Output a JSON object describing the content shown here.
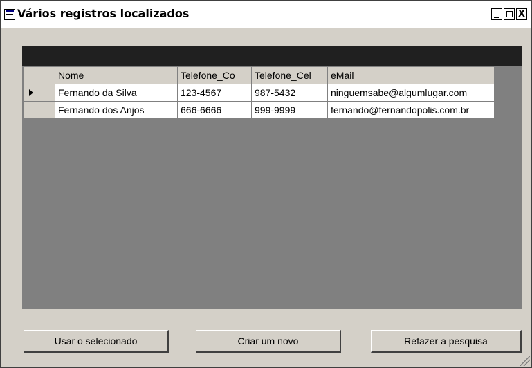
{
  "window": {
    "title": "Vários registros localizados",
    "controls": {
      "minimize": "_",
      "maximize": "□",
      "close": "X"
    }
  },
  "grid": {
    "columns": [
      "Nome",
      "Telefone_Co",
      "Telefone_Cel",
      "eMail"
    ],
    "rows": [
      {
        "selected": true,
        "cells": [
          "Fernando da Silva",
          "123-4567",
          "987-5432",
          "ninguemsabe@algumlugar.com"
        ]
      },
      {
        "selected": false,
        "cells": [
          "Fernando dos Anjos",
          "666-6666",
          "999-9999",
          "fernando@fernandopolis.com.br"
        ]
      }
    ]
  },
  "buttons": {
    "use_selected": "Usar o selecionado",
    "create_new": "Criar um novo",
    "redo_search": "Refazer a pesquisa"
  },
  "colors": {
    "face": "#d4d0c8",
    "grid_background": "#808080",
    "caption_bar": "#202020"
  }
}
